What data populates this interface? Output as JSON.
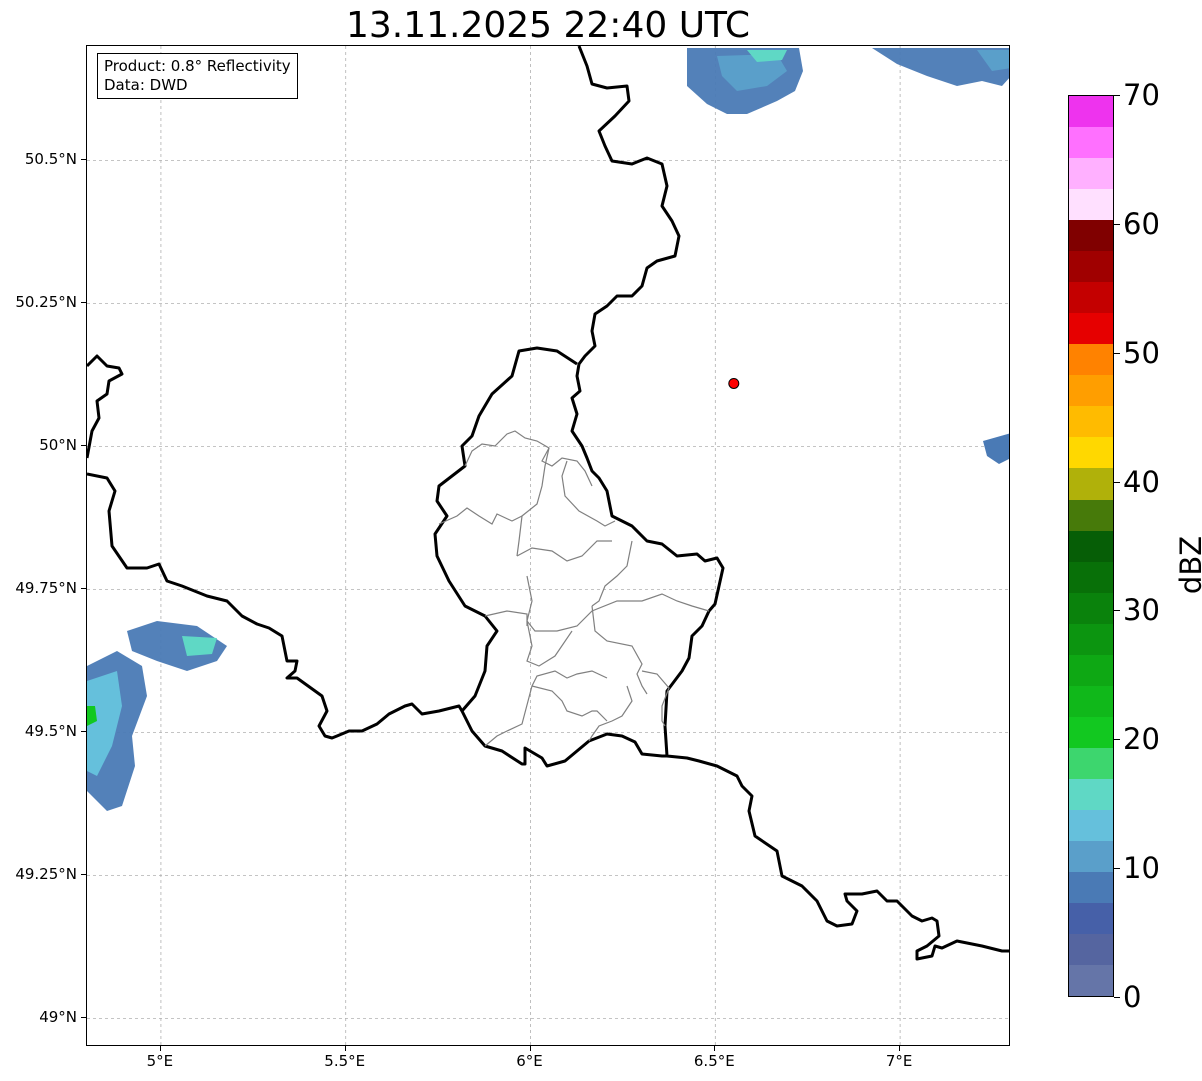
{
  "title": "13.11.2025 22:40 UTC",
  "info": {
    "product": "Product: 0.8° Reflectivity",
    "data": "Data: DWD"
  },
  "latitude_labels": [
    "50.5°N",
    "50.25°N",
    "50°N",
    "49.75°N",
    "49.5°N",
    "49.25°N",
    "49°N"
  ],
  "latitude_values": [
    50.5,
    50.25,
    50.0,
    49.75,
    49.5,
    49.25,
    49.0
  ],
  "longitude_labels": [
    "5°E",
    "5.5°E",
    "6°E",
    "6.5°E",
    "7°E"
  ],
  "longitude_values": [
    5.0,
    5.5,
    6.0,
    6.5,
    7.0
  ],
  "extent": {
    "lon_min": 4.8,
    "lon_max": 7.3,
    "lat_min": 48.95,
    "lat_max": 50.7
  },
  "marker": {
    "lon": 6.55,
    "lat": 50.11,
    "color": "#ff0000"
  },
  "colorbar": {
    "unit": "dBZ",
    "tick_labels": [
      "0",
      "10",
      "20",
      "30",
      "40",
      "50",
      "60",
      "70"
    ],
    "tick_values": [
      0,
      10,
      20,
      30,
      40,
      50,
      60,
      70
    ],
    "min": 0,
    "max": 70,
    "colors": [
      "#6575a8",
      "#5565a0",
      "#4660a8",
      "#4a7ab5",
      "#5a9fca",
      "#65c0dc",
      "#5fd8c5",
      "#3dd66e",
      "#12c820",
      "#10b81a",
      "#0ea814",
      "#0c9510",
      "#0a820c",
      "#087008",
      "#065e06",
      "#477a0a",
      "#b0b10a",
      "#ffd800",
      "#ffbb00",
      "#ff9e00",
      "#ff8200",
      "#e60000",
      "#c40000",
      "#a00000",
      "#800000",
      "#ffe0ff",
      "#ffb0ff",
      "#ff70ff",
      "#ee33ee"
    ]
  },
  "colors": {
    "border": "#000000",
    "admin": "#808080",
    "grid": "#b0b0b0"
  }
}
